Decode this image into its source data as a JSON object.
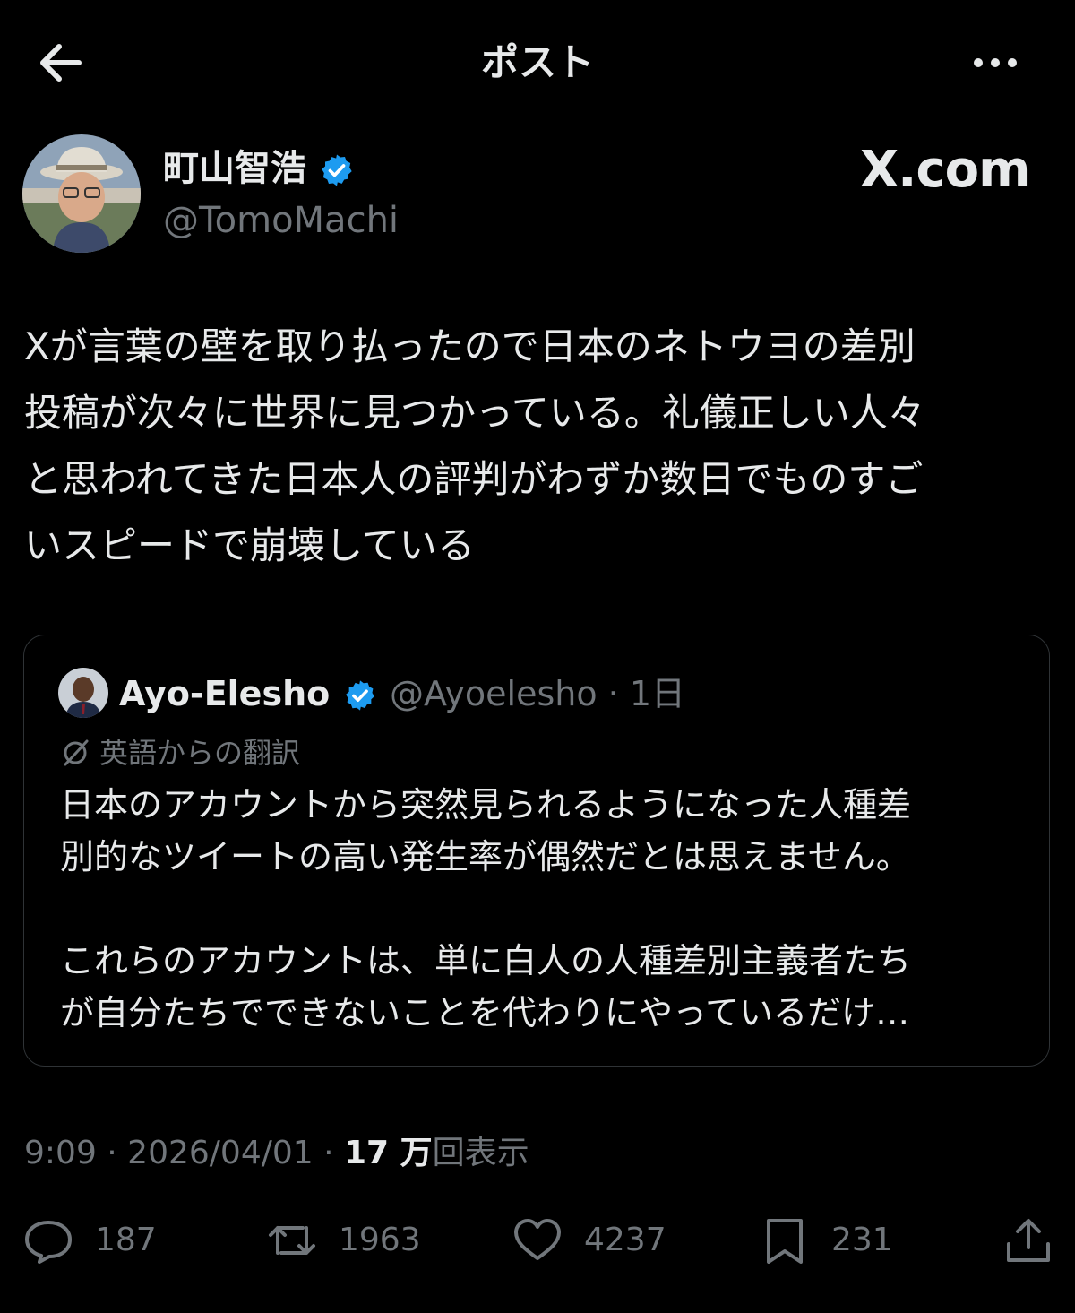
{
  "header": {
    "title": "ポスト"
  },
  "post": {
    "author_name": "町山智浩",
    "author_handle": "@TomoMachi",
    "watermark": "X.com",
    "text": "Xが言葉の壁を取り払ったので日本のネトウヨの差別\n投稿が次々に世界に見つかっている。礼儀正しい人々\nと思われてきた日本人の評判がわずか数日でものすご\nいスピードで崩壊している",
    "timestamp": "9:09 · 2026/04/01 · ",
    "views_count": "17 万",
    "views_label": "回表示"
  },
  "quote": {
    "author_name": "Ayo-Elesho",
    "author_handle": "@Ayoelesho · 1日",
    "translation_label": "英語からの翻訳",
    "text": "日本のアカウントから突然見られるようになった人種差\n別的なツイートの高い発生率が偶然だとは思えません。\n\nこれらのアカウントは、単に白人の人種差別主義者たち\nが自分たちでできないことを代わりにやっているだけ…"
  },
  "actions": {
    "replies": "187",
    "reposts": "1963",
    "likes": "4237",
    "bookmarks": "231"
  },
  "colors": {
    "background": "#000000",
    "text": "#e7e9ea",
    "secondary": "#71767b",
    "verified": "#1d9bf0",
    "border": "#2f3336"
  },
  "icons": [
    "back-arrow-icon",
    "more-icon",
    "verified-icon",
    "translate-icon",
    "reply-icon",
    "repost-icon",
    "like-icon",
    "bookmark-icon",
    "share-icon"
  ]
}
